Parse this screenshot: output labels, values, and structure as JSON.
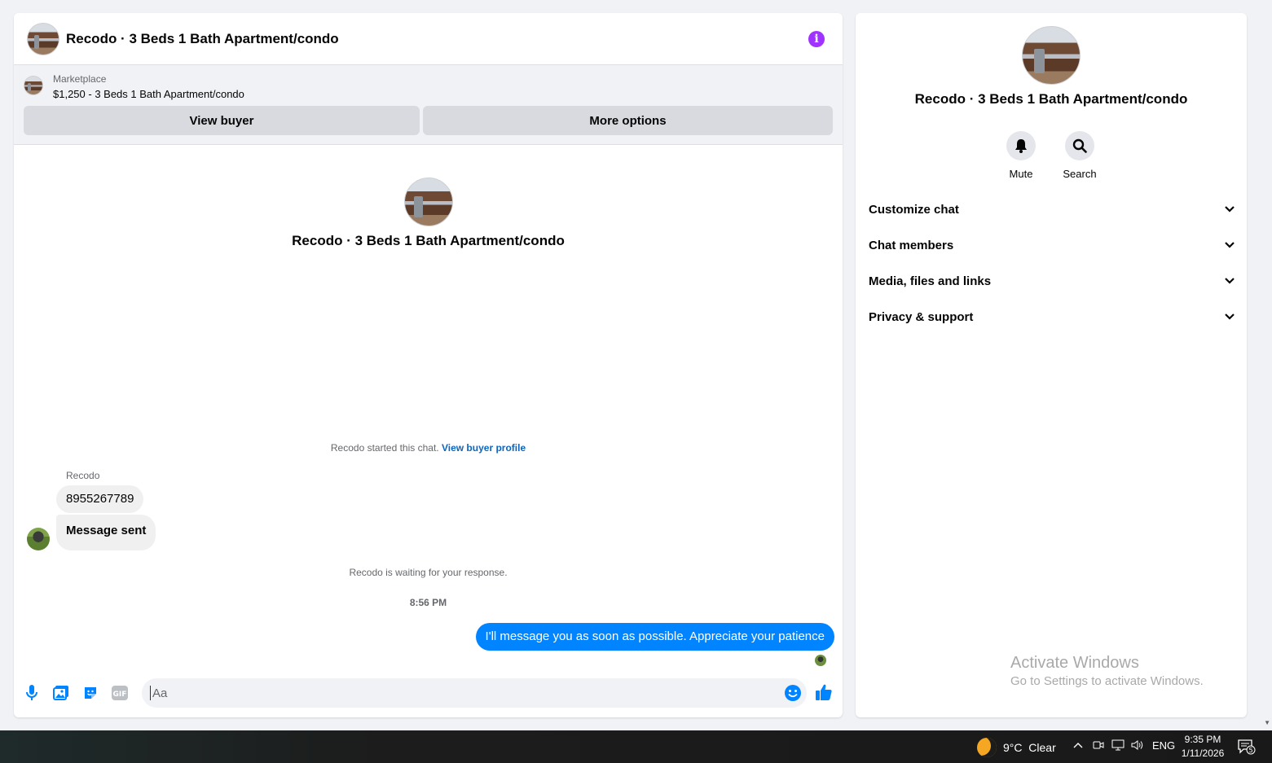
{
  "chat": {
    "title": "Recodo · 3 Beds 1 Bath Apartment/condo",
    "info_icon": "info-icon",
    "marketplace": {
      "label": "Marketplace",
      "listing": "$1,250 - 3 Beds 1 Bath Apartment/condo",
      "view_buyer": "View buyer",
      "more_options": "More options"
    },
    "intro_title": "Recodo · 3 Beds 1 Bath Apartment/condo",
    "started_text": "Recodo started this chat.",
    "view_profile_link": "View buyer profile",
    "sender_name": "Recodo",
    "incoming": [
      "8955267789",
      "Message sent"
    ],
    "waiting_text": "Recodo is waiting for your response.",
    "timestamp": "8:56 PM",
    "outgoing": "I'll message you as soon as possible. Appreciate your patience",
    "composer": {
      "placeholder": "Aa"
    }
  },
  "details": {
    "title": "Recodo · 3 Beds 1 Bath Apartment/condo",
    "actions": [
      "Mute",
      "Search"
    ],
    "sections": [
      "Customize chat",
      "Chat members",
      "Media, files and links",
      "Privacy & support"
    ]
  },
  "watermark": {
    "line1": "Activate Windows",
    "line2": "Go to Settings to activate Windows."
  },
  "taskbar": {
    "weather": "9°C  Clear",
    "language": "ENG",
    "time": "9:35 PM",
    "date": "1/11/2026",
    "notification_count": "5"
  },
  "colors": {
    "accent": "#0084ff",
    "info": "#a033ff",
    "link": "#0a66c2"
  }
}
